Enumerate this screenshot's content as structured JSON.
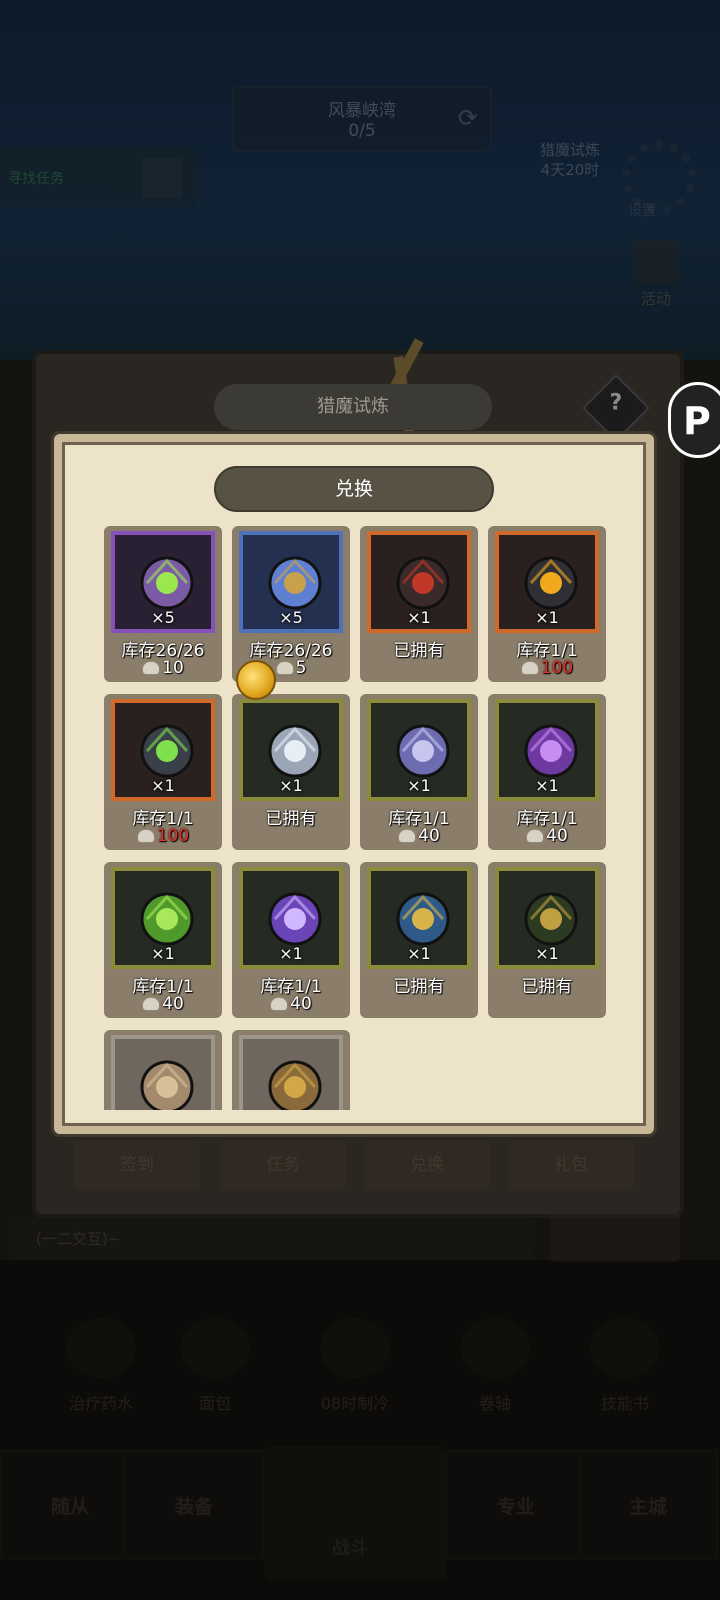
{
  "background": {
    "top_banner": {
      "title": "风暴峡湾",
      "progress": "0/5"
    },
    "left_task": "寻找任务",
    "right_timer": {
      "line1": "猎魔试炼",
      "line2": "4天20时"
    },
    "gear_label": "设置",
    "activity_label": "活动",
    "side_button_letter": "P",
    "outer_title": "猎魔试炼",
    "help_label": "?",
    "under_tabs": [
      "签到",
      "任务",
      "兑换",
      "礼包"
    ],
    "chat_hint": "(一二交互)~",
    "bottom_items": [
      "治疗药水",
      "面包",
      "08时制冷",
      "卷轴",
      "技能书"
    ],
    "nav": {
      "left1": "随从",
      "left2": "装备",
      "center": "战斗",
      "right1": "专业",
      "right2": "主城"
    }
  },
  "exchange": {
    "title": "兑换",
    "items": [
      {
        "qty": "×5",
        "status": "库存26/26",
        "price": "10",
        "frame": "purple",
        "icon": "shadow-box-icon"
      },
      {
        "qty": "×5",
        "status": "库存26/26",
        "price": "5",
        "frame": "blue",
        "icon": "gold-chest-icon"
      },
      {
        "qty": "×1",
        "status": "已拥有",
        "price": "",
        "frame": "orange",
        "icon": "red-knight-helmet-icon"
      },
      {
        "qty": "×1",
        "status": "库存1/1",
        "price": "100",
        "frame": "orange",
        "icon": "golden-eye-shield-icon",
        "price_red": true
      },
      {
        "qty": "×1",
        "status": "库存1/1",
        "price": "100",
        "frame": "orange",
        "icon": "green-orb-ring-icon",
        "price_red": true
      },
      {
        "qty": "×1",
        "status": "已拥有",
        "price": "",
        "frame": "olive",
        "icon": "silver-gem-icon"
      },
      {
        "qty": "×1",
        "status": "库存1/1",
        "price": "40",
        "frame": "olive",
        "icon": "twin-blade-icon"
      },
      {
        "qty": "×1",
        "status": "库存1/1",
        "price": "40",
        "frame": "olive",
        "icon": "purple-crystal-icon"
      },
      {
        "qty": "×1",
        "status": "库存1/1",
        "price": "40",
        "frame": "olive",
        "icon": "green-slime-icon"
      },
      {
        "qty": "×1",
        "status": "库存1/1",
        "price": "40",
        "frame": "olive",
        "icon": "purple-star-icon"
      },
      {
        "qty": "×1",
        "status": "已拥有",
        "price": "",
        "frame": "olive",
        "icon": "blue-armor-avatar-icon"
      },
      {
        "qty": "×1",
        "status": "已拥有",
        "price": "",
        "frame": "olive",
        "icon": "dark-warrior-avatar-icon"
      },
      {
        "qty": "",
        "status": "",
        "price": "",
        "frame": "gray",
        "icon": "scroll-icon"
      },
      {
        "qty": "",
        "status": "",
        "price": "",
        "frame": "gray",
        "icon": "treasure-chest-icon"
      }
    ]
  },
  "colors": {
    "panel_bg": "#ede3c9",
    "card_bg": "#8a7d6a",
    "price_red": "#e0322a",
    "title_pill": "#585245"
  }
}
